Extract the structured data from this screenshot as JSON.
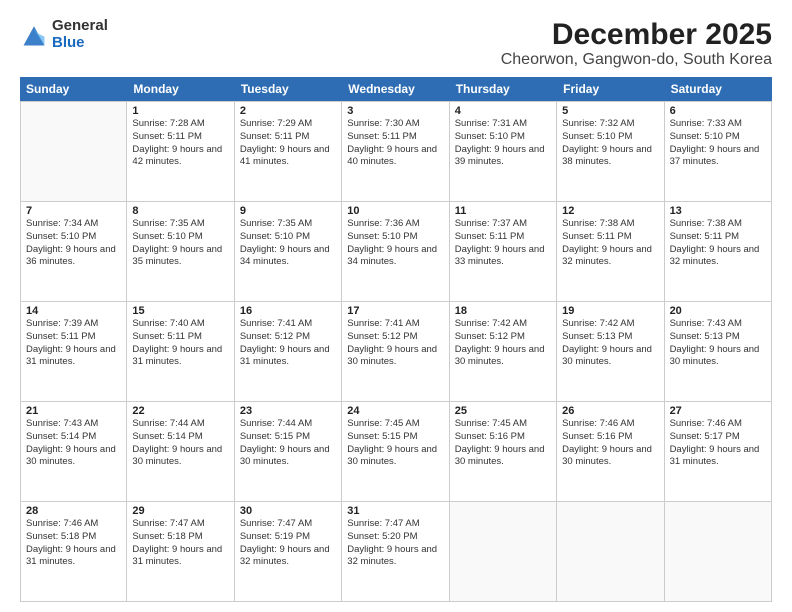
{
  "logo": {
    "general": "General",
    "blue": "Blue"
  },
  "title": "December 2025",
  "subtitle": "Cheorwon, Gangwon-do, South Korea",
  "days": [
    "Sunday",
    "Monday",
    "Tuesday",
    "Wednesday",
    "Thursday",
    "Friday",
    "Saturday"
  ],
  "weeks": [
    [
      {
        "day": "",
        "sunrise": "",
        "sunset": "",
        "daylight": ""
      },
      {
        "day": "1",
        "sunrise": "Sunrise: 7:28 AM",
        "sunset": "Sunset: 5:11 PM",
        "daylight": "Daylight: 9 hours and 42 minutes."
      },
      {
        "day": "2",
        "sunrise": "Sunrise: 7:29 AM",
        "sunset": "Sunset: 5:11 PM",
        "daylight": "Daylight: 9 hours and 41 minutes."
      },
      {
        "day": "3",
        "sunrise": "Sunrise: 7:30 AM",
        "sunset": "Sunset: 5:11 PM",
        "daylight": "Daylight: 9 hours and 40 minutes."
      },
      {
        "day": "4",
        "sunrise": "Sunrise: 7:31 AM",
        "sunset": "Sunset: 5:10 PM",
        "daylight": "Daylight: 9 hours and 39 minutes."
      },
      {
        "day": "5",
        "sunrise": "Sunrise: 7:32 AM",
        "sunset": "Sunset: 5:10 PM",
        "daylight": "Daylight: 9 hours and 38 minutes."
      },
      {
        "day": "6",
        "sunrise": "Sunrise: 7:33 AM",
        "sunset": "Sunset: 5:10 PM",
        "daylight": "Daylight: 9 hours and 37 minutes."
      }
    ],
    [
      {
        "day": "7",
        "sunrise": "Sunrise: 7:34 AM",
        "sunset": "Sunset: 5:10 PM",
        "daylight": "Daylight: 9 hours and 36 minutes."
      },
      {
        "day": "8",
        "sunrise": "Sunrise: 7:35 AM",
        "sunset": "Sunset: 5:10 PM",
        "daylight": "Daylight: 9 hours and 35 minutes."
      },
      {
        "day": "9",
        "sunrise": "Sunrise: 7:35 AM",
        "sunset": "Sunset: 5:10 PM",
        "daylight": "Daylight: 9 hours and 34 minutes."
      },
      {
        "day": "10",
        "sunrise": "Sunrise: 7:36 AM",
        "sunset": "Sunset: 5:10 PM",
        "daylight": "Daylight: 9 hours and 34 minutes."
      },
      {
        "day": "11",
        "sunrise": "Sunrise: 7:37 AM",
        "sunset": "Sunset: 5:11 PM",
        "daylight": "Daylight: 9 hours and 33 minutes."
      },
      {
        "day": "12",
        "sunrise": "Sunrise: 7:38 AM",
        "sunset": "Sunset: 5:11 PM",
        "daylight": "Daylight: 9 hours and 32 minutes."
      },
      {
        "day": "13",
        "sunrise": "Sunrise: 7:38 AM",
        "sunset": "Sunset: 5:11 PM",
        "daylight": "Daylight: 9 hours and 32 minutes."
      }
    ],
    [
      {
        "day": "14",
        "sunrise": "Sunrise: 7:39 AM",
        "sunset": "Sunset: 5:11 PM",
        "daylight": "Daylight: 9 hours and 31 minutes."
      },
      {
        "day": "15",
        "sunrise": "Sunrise: 7:40 AM",
        "sunset": "Sunset: 5:11 PM",
        "daylight": "Daylight: 9 hours and 31 minutes."
      },
      {
        "day": "16",
        "sunrise": "Sunrise: 7:41 AM",
        "sunset": "Sunset: 5:12 PM",
        "daylight": "Daylight: 9 hours and 31 minutes."
      },
      {
        "day": "17",
        "sunrise": "Sunrise: 7:41 AM",
        "sunset": "Sunset: 5:12 PM",
        "daylight": "Daylight: 9 hours and 30 minutes."
      },
      {
        "day": "18",
        "sunrise": "Sunrise: 7:42 AM",
        "sunset": "Sunset: 5:12 PM",
        "daylight": "Daylight: 9 hours and 30 minutes."
      },
      {
        "day": "19",
        "sunrise": "Sunrise: 7:42 AM",
        "sunset": "Sunset: 5:13 PM",
        "daylight": "Daylight: 9 hours and 30 minutes."
      },
      {
        "day": "20",
        "sunrise": "Sunrise: 7:43 AM",
        "sunset": "Sunset: 5:13 PM",
        "daylight": "Daylight: 9 hours and 30 minutes."
      }
    ],
    [
      {
        "day": "21",
        "sunrise": "Sunrise: 7:43 AM",
        "sunset": "Sunset: 5:14 PM",
        "daylight": "Daylight: 9 hours and 30 minutes."
      },
      {
        "day": "22",
        "sunrise": "Sunrise: 7:44 AM",
        "sunset": "Sunset: 5:14 PM",
        "daylight": "Daylight: 9 hours and 30 minutes."
      },
      {
        "day": "23",
        "sunrise": "Sunrise: 7:44 AM",
        "sunset": "Sunset: 5:15 PM",
        "daylight": "Daylight: 9 hours and 30 minutes."
      },
      {
        "day": "24",
        "sunrise": "Sunrise: 7:45 AM",
        "sunset": "Sunset: 5:15 PM",
        "daylight": "Daylight: 9 hours and 30 minutes."
      },
      {
        "day": "25",
        "sunrise": "Sunrise: 7:45 AM",
        "sunset": "Sunset: 5:16 PM",
        "daylight": "Daylight: 9 hours and 30 minutes."
      },
      {
        "day": "26",
        "sunrise": "Sunrise: 7:46 AM",
        "sunset": "Sunset: 5:16 PM",
        "daylight": "Daylight: 9 hours and 30 minutes."
      },
      {
        "day": "27",
        "sunrise": "Sunrise: 7:46 AM",
        "sunset": "Sunset: 5:17 PM",
        "daylight": "Daylight: 9 hours and 31 minutes."
      }
    ],
    [
      {
        "day": "28",
        "sunrise": "Sunrise: 7:46 AM",
        "sunset": "Sunset: 5:18 PM",
        "daylight": "Daylight: 9 hours and 31 minutes."
      },
      {
        "day": "29",
        "sunrise": "Sunrise: 7:47 AM",
        "sunset": "Sunset: 5:18 PM",
        "daylight": "Daylight: 9 hours and 31 minutes."
      },
      {
        "day": "30",
        "sunrise": "Sunrise: 7:47 AM",
        "sunset": "Sunset: 5:19 PM",
        "daylight": "Daylight: 9 hours and 32 minutes."
      },
      {
        "day": "31",
        "sunrise": "Sunrise: 7:47 AM",
        "sunset": "Sunset: 5:20 PM",
        "daylight": "Daylight: 9 hours and 32 minutes."
      },
      {
        "day": "",
        "sunrise": "",
        "sunset": "",
        "daylight": ""
      },
      {
        "day": "",
        "sunrise": "",
        "sunset": "",
        "daylight": ""
      },
      {
        "day": "",
        "sunrise": "",
        "sunset": "",
        "daylight": ""
      }
    ]
  ]
}
